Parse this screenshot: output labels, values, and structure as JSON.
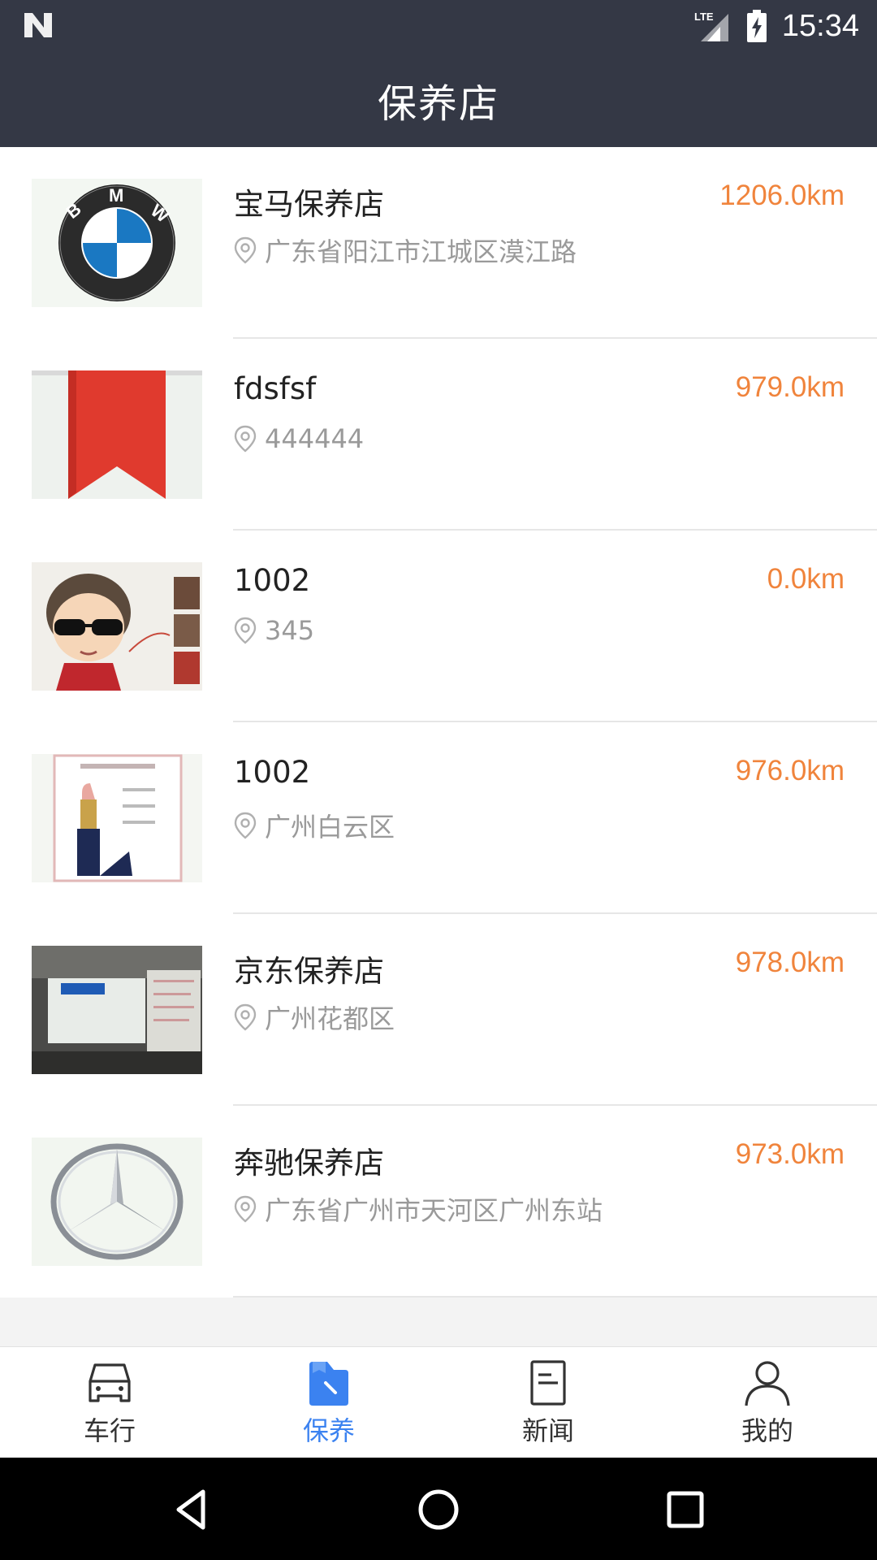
{
  "status_bar": {
    "network": "LTE",
    "time": "15:34"
  },
  "header": {
    "title": "保养店"
  },
  "shops": [
    {
      "name": "宝马保养店",
      "distance": "1206.0km",
      "address": "广东省阳江市江城区漠江路",
      "thumb": "bmw-logo"
    },
    {
      "name": "fdsfsf",
      "distance": "979.0km",
      "address": "444444",
      "thumb": "red-ribbon"
    },
    {
      "name": "1002",
      "distance": "0.0km",
      "address": "345",
      "thumb": "cartoon-avatar"
    },
    {
      "name": "1002",
      "distance": "976.0km",
      "address": "广州白云区",
      "thumb": "lipstick-ad"
    },
    {
      "name": "京东保养店",
      "distance": "978.0km",
      "address": "广州花都区",
      "thumb": "office-photo"
    },
    {
      "name": "奔驰保养店",
      "distance": "973.0km",
      "address": "广东省广州市天河区广州东站",
      "thumb": "mercedes-logo"
    }
  ],
  "bottom_nav": {
    "items": [
      {
        "label": "车行",
        "icon": "car-icon",
        "active": false
      },
      {
        "label": "保养",
        "icon": "maintenance-bookmark-icon",
        "active": true
      },
      {
        "label": "新闻",
        "icon": "news-icon",
        "active": false
      },
      {
        "label": "我的",
        "icon": "person-icon",
        "active": false
      }
    ]
  },
  "colors": {
    "header_bg": "#343845",
    "distance": "#f0843c",
    "active_tab": "#3b82f0"
  }
}
